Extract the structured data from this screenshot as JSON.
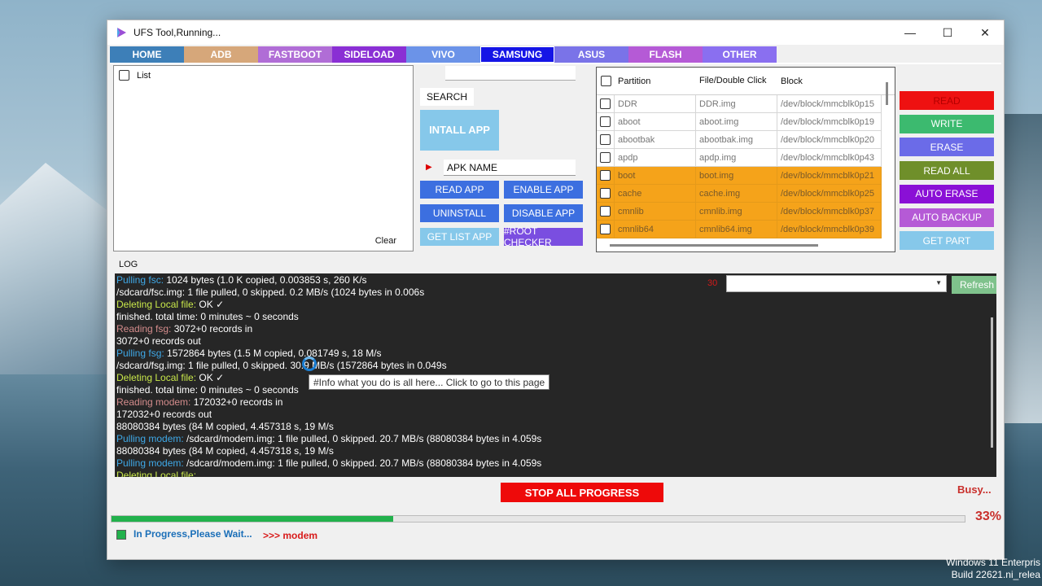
{
  "window": {
    "title": "UFS Tool,Running..."
  },
  "tabs": [
    {
      "label": "HOME",
      "color": "#3d7fb8"
    },
    {
      "label": "ADB",
      "color": "#d6a77a"
    },
    {
      "label": "FASTBOOT",
      "color": "#b06dd6"
    },
    {
      "label": "SIDELOAD",
      "color": "#8a2fd4"
    },
    {
      "label": "VIVO",
      "color": "#6b93e8"
    },
    {
      "label": "SAMSUNG",
      "color": "#1515e6"
    },
    {
      "label": "ASUS",
      "color": "#7a73e8"
    },
    {
      "label": "FLASH",
      "color": "#b55ad6"
    },
    {
      "label": "OTHER",
      "color": "#8a6ff0"
    }
  ],
  "app_list": {
    "header": "List",
    "clear": "Clear"
  },
  "middle": {
    "search": "SEARCH",
    "install": "INTALL APP",
    "apk_name": "APK NAME",
    "buttons": [
      {
        "label": "READ APP",
        "color": "#3c6fe0"
      },
      {
        "label": "ENABLE APP",
        "color": "#3c6fe0"
      },
      {
        "label": "UNINSTALL",
        "color": "#3c6fe0"
      },
      {
        "label": "DISABLE APP",
        "color": "#3c6fe0"
      },
      {
        "label": "GET LIST APP",
        "color": "#86c8ea"
      },
      {
        "label": "#ROOT CHECKER",
        "color": "#7a4ee0"
      }
    ]
  },
  "partitions": {
    "columns": [
      "Partition",
      "File/Double Click",
      "Block"
    ],
    "rows": [
      {
        "name": "DDR",
        "file": "DDR.img",
        "block": "/dev/block/mmcblk0p15",
        "highlight": false
      },
      {
        "name": "aboot",
        "file": "aboot.img",
        "block": "/dev/block/mmcblk0p19",
        "highlight": false
      },
      {
        "name": "abootbak",
        "file": "abootbak.img",
        "block": "/dev/block/mmcblk0p20",
        "highlight": false
      },
      {
        "name": "apdp",
        "file": "apdp.img",
        "block": "/dev/block/mmcblk0p43",
        "highlight": false
      },
      {
        "name": "boot",
        "file": "boot.img",
        "block": "/dev/block/mmcblk0p21",
        "highlight": true
      },
      {
        "name": "cache",
        "file": "cache.img",
        "block": "/dev/block/mmcblk0p25",
        "highlight": true
      },
      {
        "name": "cmnlib",
        "file": "cmnlib.img",
        "block": "/dev/block/mmcblk0p37",
        "highlight": true
      },
      {
        "name": "cmnlib64",
        "file": "cmnlib64.img",
        "block": "/dev/block/mmcblk0p39",
        "highlight": true
      }
    ]
  },
  "actions": [
    {
      "label": "READ",
      "color": "#ee1111"
    },
    {
      "label": "WRITE",
      "color": "#3cba6f"
    },
    {
      "label": "ERASE",
      "color": "#6b6be8"
    },
    {
      "label": "READ ALL",
      "color": "#6f8f2a"
    },
    {
      "label": "AUTO ERASE",
      "color": "#8a10d6"
    },
    {
      "label": "AUTO BACKUP",
      "color": "#b55ad6"
    },
    {
      "label": "GET PART",
      "color": "#86c8ea"
    }
  ],
  "log": {
    "label": "LOG",
    "count": "30",
    "refresh": "Refresh",
    "lines": [
      [
        {
          "t": "Pulling fsc: ",
          "c": "blue"
        },
        {
          "t": "1024 bytes (1.0 K copied, 0.003853 s, 260 K/s",
          "c": "w"
        }
      ],
      [
        {
          "t": "/sdcard/fsc.img: 1 file pulled, 0 skipped. 0.2 MB/s (1024 bytes in 0.006s",
          "c": "w"
        }
      ],
      [
        {
          "t": "Deleting Local file:  ",
          "c": "green"
        },
        {
          "t": "OK ✓",
          "c": "w"
        }
      ],
      [
        {
          "t": "finished. total time: 0 minutes ~ 0 seconds",
          "c": "w"
        }
      ],
      [
        {
          "t": "Reading fsg: ",
          "c": "pink"
        },
        {
          "t": "3072+0 records in",
          "c": "w"
        }
      ],
      [
        {
          "t": "3072+0 records out",
          "c": "w"
        }
      ],
      [
        {
          "t": "Pulling fsg: ",
          "c": "blue"
        },
        {
          "t": "1572864 bytes (1.5 M copied, 0.081749 s, 18 M/s",
          "c": "w"
        }
      ],
      [
        {
          "t": "/sdcard/fsg.img: 1 file pulled, 0 skipped. 30.9 MB/s (1572864 bytes in 0.049s",
          "c": "w"
        }
      ],
      [
        {
          "t": "Deleting Local file:  ",
          "c": "green"
        },
        {
          "t": "OK ✓",
          "c": "w"
        }
      ],
      [
        {
          "t": "finished. total time: 0 minutes ~ 0 seconds",
          "c": "w"
        }
      ],
      [
        {
          "t": "Reading modem: ",
          "c": "pink"
        },
        {
          "t": "172032+0 records in",
          "c": "w"
        }
      ],
      [
        {
          "t": "172032+0 records out",
          "c": "w"
        }
      ],
      [
        {
          "t": "88080384 bytes (84 M copied, 4.457318 s, 19 M/s",
          "c": "w"
        }
      ],
      [
        {
          "t": "Pulling modem: ",
          "c": "blue"
        },
        {
          "t": "/sdcard/modem.img: 1 file pulled, 0 skipped. 20.7 MB/s (88080384 bytes in 4.059s",
          "c": "w"
        }
      ],
      [
        {
          "t": "88080384 bytes (84 M copied, 4.457318 s, 19 M/s",
          "c": "w"
        }
      ],
      [
        {
          "t": "Pulling modem: ",
          "c": "blue"
        },
        {
          "t": "/sdcard/modem.img: 1 file pulled, 0 skipped. 20.7 MB/s (88080384 bytes in 4.059s",
          "c": "w"
        }
      ],
      [
        {
          "t": "Deleting Local file:",
          "c": "green"
        }
      ]
    ],
    "tooltip": "#Info what you do is all here... Click to go to this page"
  },
  "bottom": {
    "stop": "STOP ALL PROGRESS",
    "busy": "Busy...",
    "progress_fraction": 0.33,
    "percent": "33%",
    "status": "In Progress,Please Wait...",
    "stage": ">>> modem"
  },
  "desktop": {
    "watermark_line1": "Windows 11 Enterpris",
    "watermark_line2": "Build 22621.ni_relea"
  }
}
